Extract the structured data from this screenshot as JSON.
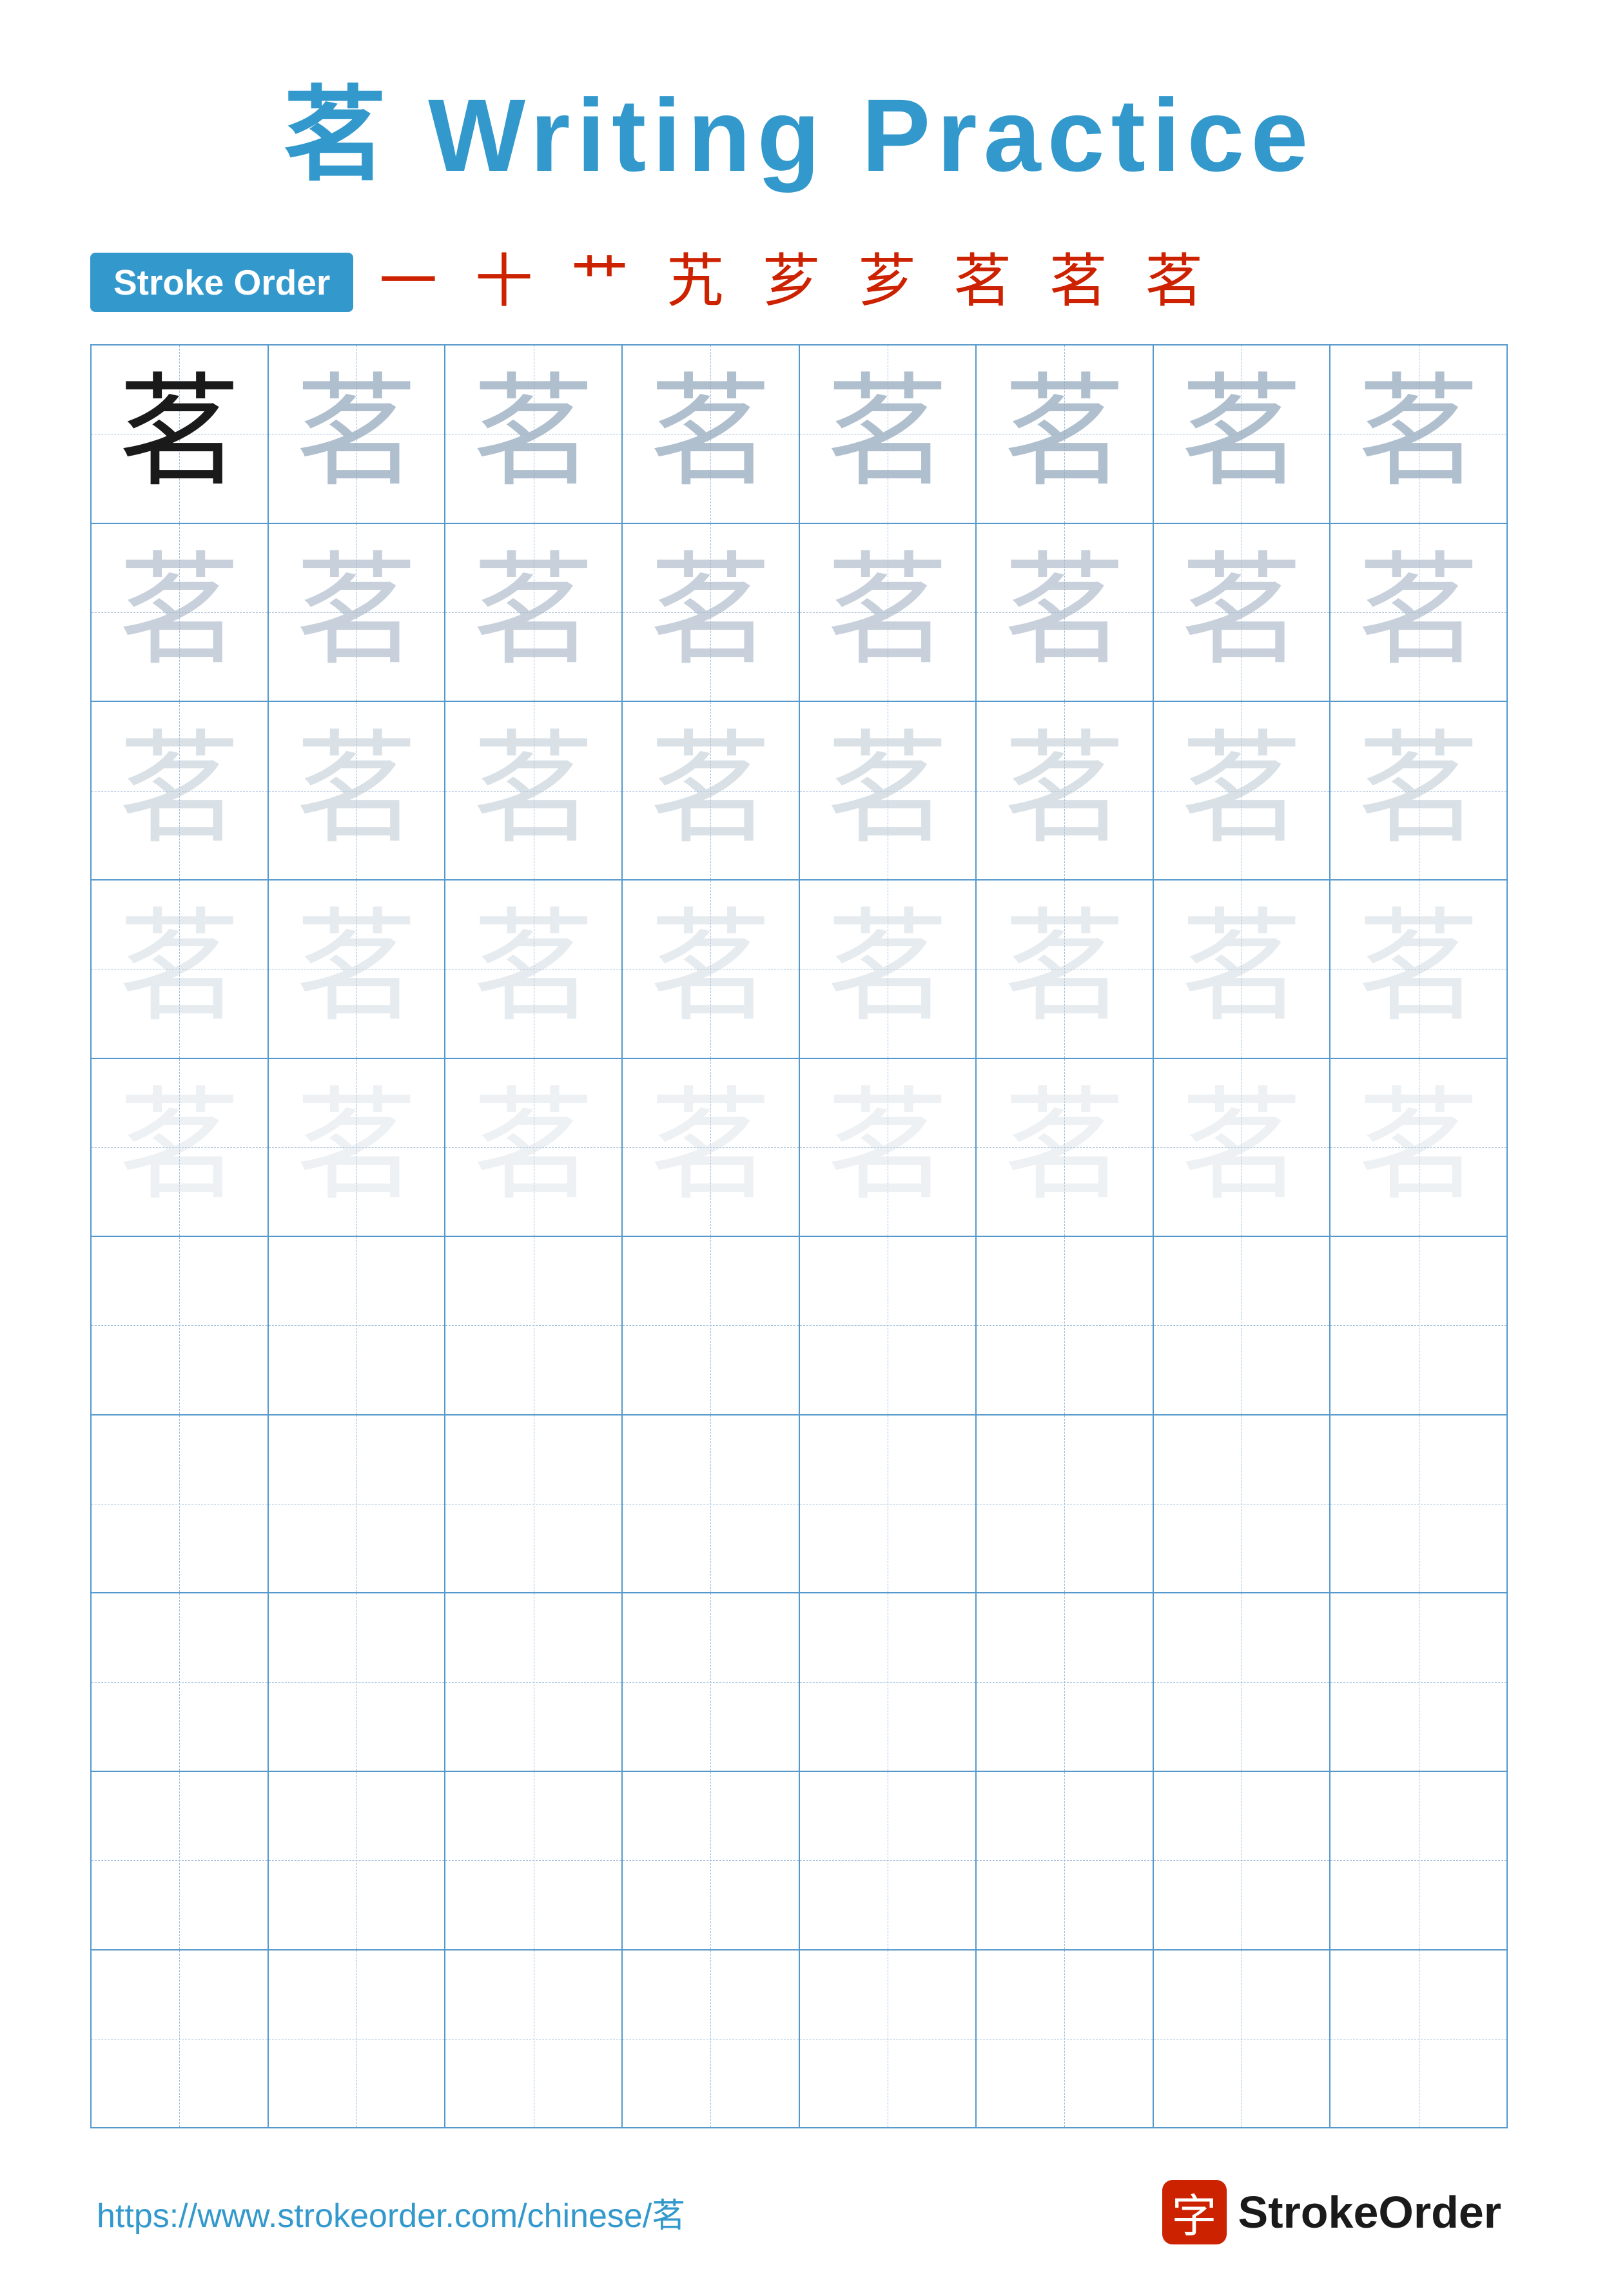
{
  "title": {
    "char": "茗",
    "text": " Writing Practice"
  },
  "strokeOrder": {
    "badge": "Stroke Order",
    "strokes": "一 十 艹 艽 芗 芗 茗 茗 茗"
  },
  "grid": {
    "rows": 10,
    "cols": 8,
    "char": "茗",
    "filledRows": 5,
    "emptyRows": 5
  },
  "footer": {
    "url": "https://www.strokeorder.com/chinese/茗",
    "logoChar": "字",
    "logoText": "StrokeOrder"
  },
  "colors": {
    "accent": "#3399cc",
    "red": "#cc2200",
    "dark": "#1a1a1a",
    "gridBorder": "#5599cc",
    "guideDash": "#99bbdd"
  }
}
